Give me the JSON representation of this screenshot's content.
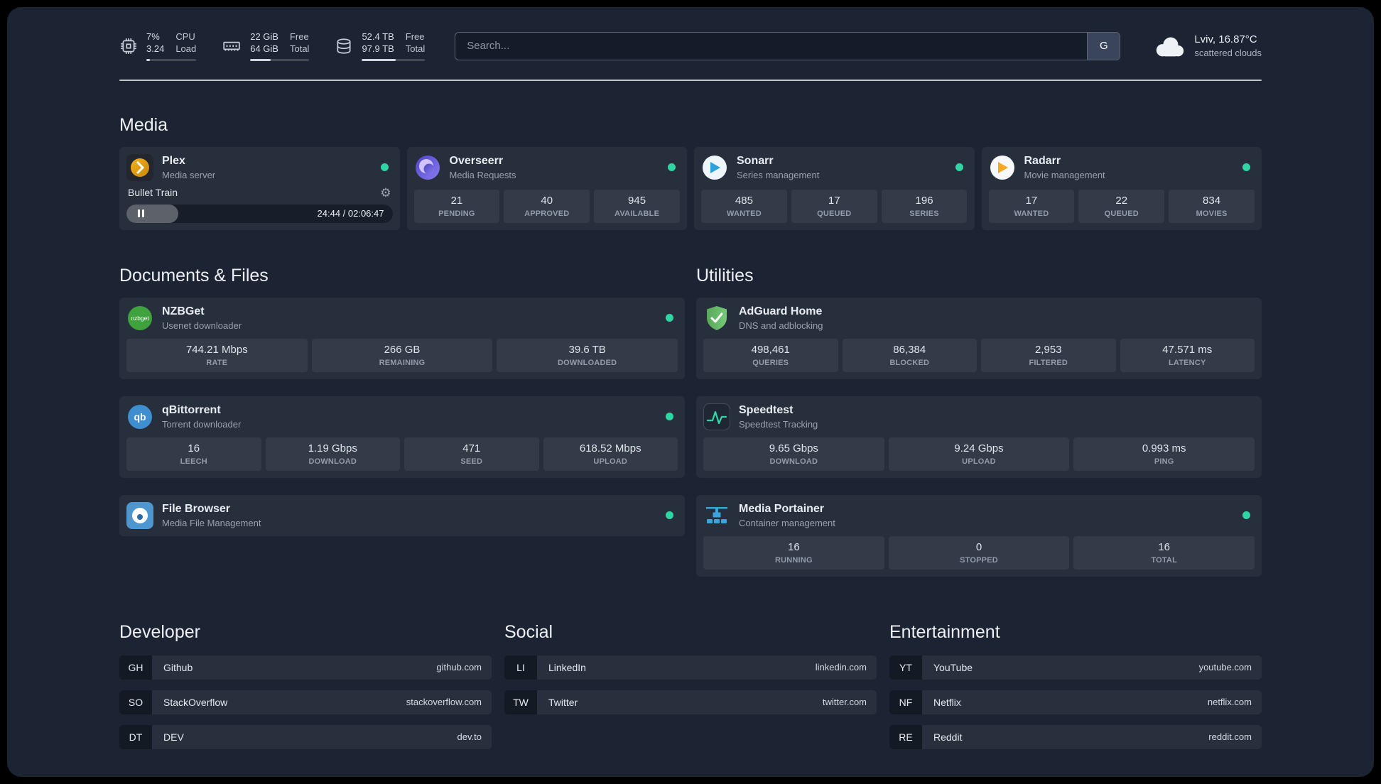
{
  "header": {
    "cpu": {
      "value1": "7%",
      "value2": "3.24",
      "label1": "CPU",
      "label2": "Load",
      "percent": 7
    },
    "ram": {
      "value1": "22 GiB",
      "value2": "64 GiB",
      "label1": "Free",
      "label2": "Total",
      "percent": 34
    },
    "disk": {
      "value1": "52.4 TB",
      "value2": "97.9 TB",
      "label1": "Free",
      "label2": "Total",
      "percent": 54
    },
    "search": {
      "placeholder": "Search...",
      "button_label": "G"
    },
    "weather": {
      "location": "Lviv, 16.87°C",
      "condition": "scattered clouds"
    }
  },
  "media": {
    "section_title": "Media",
    "plex": {
      "title": "Plex",
      "subtitle": "Media server",
      "now_playing": "Bullet Train",
      "progress_time": "24:44 / 02:06:47",
      "progress_percent": 19.5
    },
    "overseerr": {
      "title": "Overseerr",
      "subtitle": "Media Requests",
      "stats": [
        {
          "value": "21",
          "label": "PENDING"
        },
        {
          "value": "40",
          "label": "APPROVED"
        },
        {
          "value": "945",
          "label": "AVAILABLE"
        }
      ]
    },
    "sonarr": {
      "title": "Sonarr",
      "subtitle": "Series management",
      "stats": [
        {
          "value": "485",
          "label": "WANTED"
        },
        {
          "value": "17",
          "label": "QUEUED"
        },
        {
          "value": "196",
          "label": "SERIES"
        }
      ]
    },
    "radarr": {
      "title": "Radarr",
      "subtitle": "Movie management",
      "stats": [
        {
          "value": "17",
          "label": "WANTED"
        },
        {
          "value": "22",
          "label": "QUEUED"
        },
        {
          "value": "834",
          "label": "MOVIES"
        }
      ]
    }
  },
  "documents": {
    "section_title": "Documents & Files",
    "nzbget": {
      "title": "NZBGet",
      "subtitle": "Usenet downloader",
      "stats": [
        {
          "value": "744.21 Mbps",
          "label": "RATE"
        },
        {
          "value": "266 GB",
          "label": "REMAINING"
        },
        {
          "value": "39.6 TB",
          "label": "DOWNLOADED"
        }
      ]
    },
    "qbittorrent": {
      "title": "qBittorrent",
      "subtitle": "Torrent downloader",
      "stats": [
        {
          "value": "16",
          "label": "LEECH"
        },
        {
          "value": "1.19 Gbps",
          "label": "DOWNLOAD"
        },
        {
          "value": "471",
          "label": "SEED"
        },
        {
          "value": "618.52 Mbps",
          "label": "UPLOAD"
        }
      ]
    },
    "filebrowser": {
      "title": "File Browser",
      "subtitle": "Media File Management"
    }
  },
  "utilities": {
    "section_title": "Utilities",
    "adguard": {
      "title": "AdGuard Home",
      "subtitle": "DNS and adblocking",
      "stats": [
        {
          "value": "498,461",
          "label": "QUERIES"
        },
        {
          "value": "86,384",
          "label": "BLOCKED"
        },
        {
          "value": "2,953",
          "label": "FILTERED"
        },
        {
          "value": "47.571 ms",
          "label": "LATENCY"
        }
      ]
    },
    "speedtest": {
      "title": "Speedtest",
      "subtitle": "Speedtest Tracking",
      "stats": [
        {
          "value": "9.65 Gbps",
          "label": "DOWNLOAD"
        },
        {
          "value": "9.24 Gbps",
          "label": "UPLOAD"
        },
        {
          "value": "0.993 ms",
          "label": "PING"
        }
      ]
    },
    "portainer": {
      "title": "Media Portainer",
      "subtitle": "Container management",
      "stats": [
        {
          "value": "16",
          "label": "RUNNING"
        },
        {
          "value": "0",
          "label": "STOPPED"
        },
        {
          "value": "16",
          "label": "TOTAL"
        }
      ]
    }
  },
  "bookmarks": {
    "developer": {
      "section_title": "Developer",
      "items": [
        {
          "abbr": "GH",
          "name": "Github",
          "url": "github.com"
        },
        {
          "abbr": "SO",
          "name": "StackOverflow",
          "url": "stackoverflow.com"
        },
        {
          "abbr": "DT",
          "name": "DEV",
          "url": "dev.to"
        }
      ]
    },
    "social": {
      "section_title": "Social",
      "items": [
        {
          "abbr": "LI",
          "name": "LinkedIn",
          "url": "linkedin.com"
        },
        {
          "abbr": "TW",
          "name": "Twitter",
          "url": "twitter.com"
        }
      ]
    },
    "entertainment": {
      "section_title": "Entertainment",
      "items": [
        {
          "abbr": "YT",
          "name": "YouTube",
          "url": "youtube.com"
        },
        {
          "abbr": "NF",
          "name": "Netflix",
          "url": "netflix.com"
        },
        {
          "abbr": "RE",
          "name": "Reddit",
          "url": "reddit.com"
        }
      ]
    }
  },
  "icons": {
    "gear": "⚙",
    "nzbget_label": "nzbget",
    "qbittorrent_label": "qb"
  },
  "colors": {
    "status_online": "#2fd6a4",
    "plex_amber": "#e5a00d",
    "overseerr_purple": "#7b6ef6",
    "sonarr_blue": "#2aa3dc",
    "radarr_amber": "#f9a825",
    "nzbget_green": "#3fa23c",
    "qbittorrent_blue": "#3f8fd0",
    "filebrowser_blue": "#4e96cf",
    "adguard_green": "#68bc71",
    "speedtest_green": "#2fd6a4",
    "portainer_blue": "#3aa4dd"
  }
}
